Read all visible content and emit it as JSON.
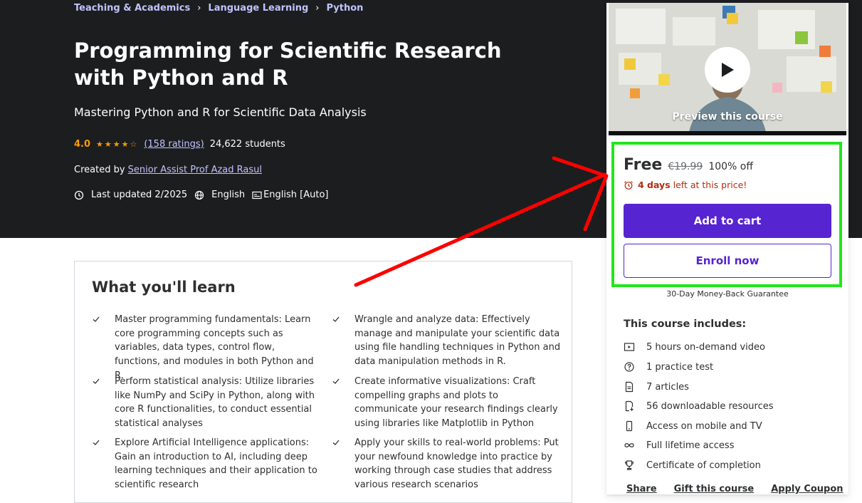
{
  "breadcrumbs": [
    "Teaching & Academics",
    "Language Learning",
    "Python"
  ],
  "course": {
    "title": "Programming for Scientific Research with Python and R",
    "subtitle": "Mastering Python and R for Scientific Data Analysis",
    "rating": "4.0",
    "stars_value": 4,
    "ratings_count": "(158 ratings)",
    "students": "24,622 students",
    "created_by_label": "Created by",
    "instructor": "Senior Assist Prof Azad Rasul",
    "last_updated": "Last updated 2/2025",
    "language": "English",
    "captions": "English [Auto]"
  },
  "learn": {
    "heading": "What you'll learn",
    "items": [
      "Master programming fundamentals: Learn core programming concepts such as variables, data types, control flow, functions, and modules in both Python and R.",
      "Wrangle and analyze data: Effectively manage and manipulate your scientific data using file handling techniques in Python and data manipulation methods in R.",
      "Perform statistical analysis: Utilize libraries like NumPy and SciPy in Python, along with core R functionalities, to conduct essential statistical analyses",
      "Create informative visualizations: Craft compelling graphs and plots to communicate your research findings clearly using libraries like Matplotlib in Python",
      "Explore Artificial Intelligence applications: Gain an introduction to AI, including deep learning techniques and their application to scientific research",
      "Apply your skills to real-world problems: Put your newfound knowledge into practice by working through case studies that address various research scenarios"
    ]
  },
  "sidebar": {
    "preview_label": "Preview this course",
    "price": "Free",
    "original_price": "€19.99",
    "discount": "100% off",
    "urgency_bold": "4 days",
    "urgency_rest": "left at this price!",
    "add_to_cart": "Add to cart",
    "enroll_now": "Enroll now",
    "guarantee": "30-Day Money-Back Guarantee",
    "includes_title": "This course includes:",
    "includes": [
      {
        "icon": "video-icon",
        "label": "5 hours on-demand video"
      },
      {
        "icon": "question-circle-icon",
        "label": "1 practice test"
      },
      {
        "icon": "article-icon",
        "label": "7 articles"
      },
      {
        "icon": "download-file-icon",
        "label": "56 downloadable resources"
      },
      {
        "icon": "mobile-icon",
        "label": "Access on mobile and TV"
      },
      {
        "icon": "infinity-icon",
        "label": "Full lifetime access"
      },
      {
        "icon": "trophy-icon",
        "label": "Certificate of completion"
      }
    ],
    "bottom_links": [
      "Share",
      "Gift this course",
      "Apply Coupon"
    ]
  },
  "colors": {
    "hero_bg": "#1c1d1f",
    "link_purple": "#c0c4fc",
    "star_orange": "#f69c08",
    "brand_purple": "#5624d0",
    "urgency_red": "#b32d0f",
    "highlight_green": "#22e51c",
    "arrow_red": "#ff0000"
  }
}
